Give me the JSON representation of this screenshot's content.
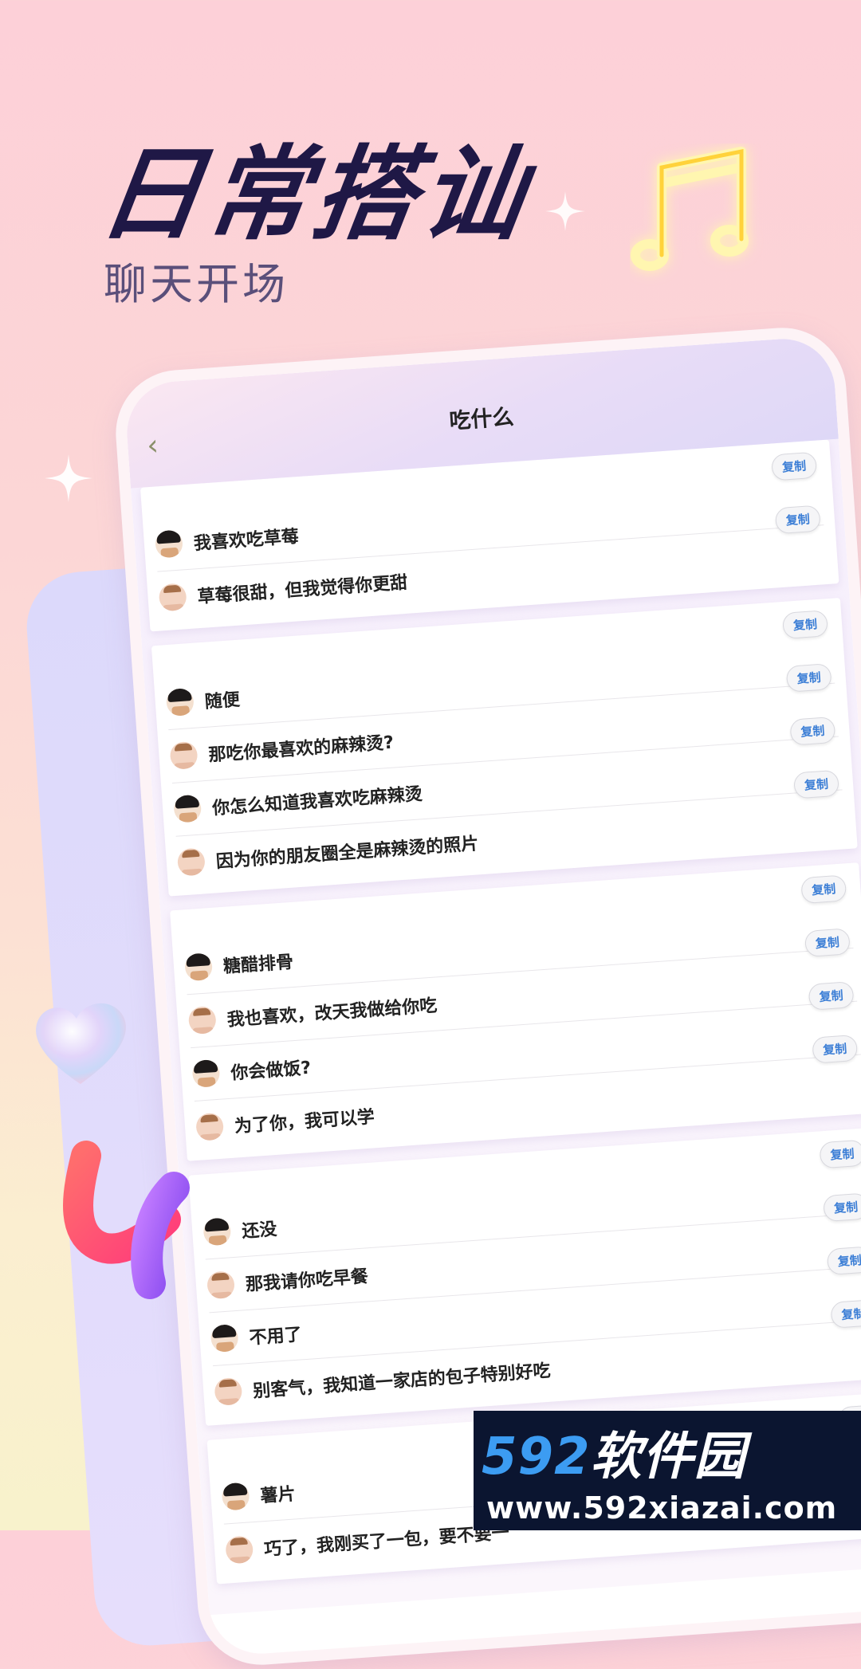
{
  "hero": {
    "title": "日常搭讪",
    "subtitle": "聊天开场"
  },
  "tablet": {
    "title": "吃什么",
    "back_symbol": "‹",
    "copy_label": "复制"
  },
  "groups": [
    {
      "lines": [
        {
          "speaker": "girl",
          "text": "我喜欢吃草莓"
        },
        {
          "speaker": "boy",
          "text": "草莓很甜，但我觉得你更甜"
        }
      ]
    },
    {
      "lines": [
        {
          "speaker": "girl",
          "text": "随便"
        },
        {
          "speaker": "boy",
          "text": "那吃你最喜欢的麻辣烫?"
        },
        {
          "speaker": "girl",
          "text": "你怎么知道我喜欢吃麻辣烫"
        },
        {
          "speaker": "boy",
          "text": "因为你的朋友圈全是麻辣烫的照片"
        }
      ]
    },
    {
      "lines": [
        {
          "speaker": "girl",
          "text": "糖醋排骨"
        },
        {
          "speaker": "boy",
          "text": "我也喜欢，改天我做给你吃"
        },
        {
          "speaker": "girl",
          "text": "你会做饭?"
        },
        {
          "speaker": "boy",
          "text": "为了你，我可以学"
        }
      ]
    },
    {
      "lines": [
        {
          "speaker": "girl",
          "text": "还没"
        },
        {
          "speaker": "boy",
          "text": "那我请你吃早餐"
        },
        {
          "speaker": "girl",
          "text": "不用了"
        },
        {
          "speaker": "boy",
          "text": "别客气，我知道一家店的包子特别好吃"
        }
      ]
    },
    {
      "lines": [
        {
          "speaker": "girl",
          "text": "薯片"
        },
        {
          "speaker": "boy",
          "text": "巧了，我刚买了一包，要不要一"
        }
      ]
    }
  ],
  "watermark": {
    "logo_num": "592",
    "logo_cn": "软件园",
    "url": "www.592xiazai.com"
  },
  "colors": {
    "title": "#1f1846",
    "copy_text": "#3d7fd6",
    "watermark_bg": "#0b1530",
    "watermark_num": "#3c9cf2"
  }
}
